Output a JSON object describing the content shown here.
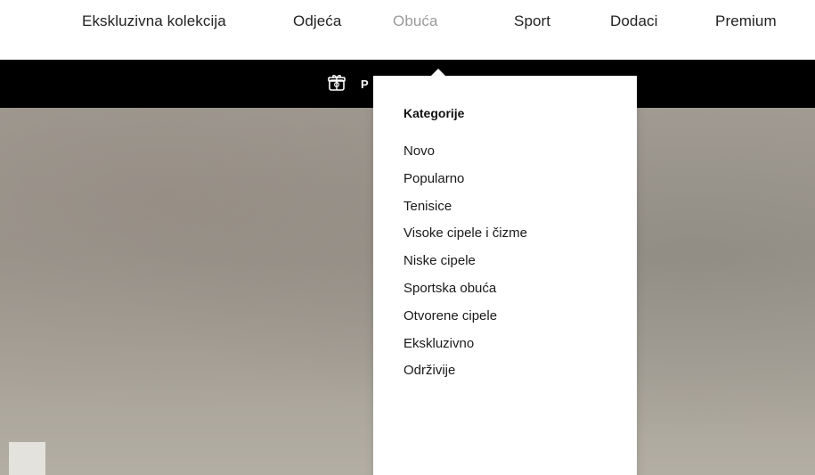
{
  "nav": {
    "items": [
      {
        "label": "Ekskluzivna kolekcija",
        "active": false
      },
      {
        "label": "Odjeća",
        "active": false
      },
      {
        "label": "Obuća",
        "active": true
      },
      {
        "label": "Sport",
        "active": false
      },
      {
        "label": "Dodaci",
        "active": false
      },
      {
        "label": "Premium",
        "active": false
      }
    ]
  },
  "promo": {
    "icon": "gift-box-icon",
    "text": "P"
  },
  "dropdown": {
    "heading": "Kategorije",
    "items": [
      "Novo",
      "Popularno",
      "Tenisice",
      "Visoke cipele i čizme",
      "Niske cipele",
      "Sportska obuća",
      "Otvorene cipele",
      "Ekskluzivno",
      "Održivije"
    ]
  },
  "colors": {
    "nav_text": "#222222",
    "nav_active": "#9a9a9a",
    "promo_bg": "#000000",
    "hero_bg": "#a39d95"
  }
}
